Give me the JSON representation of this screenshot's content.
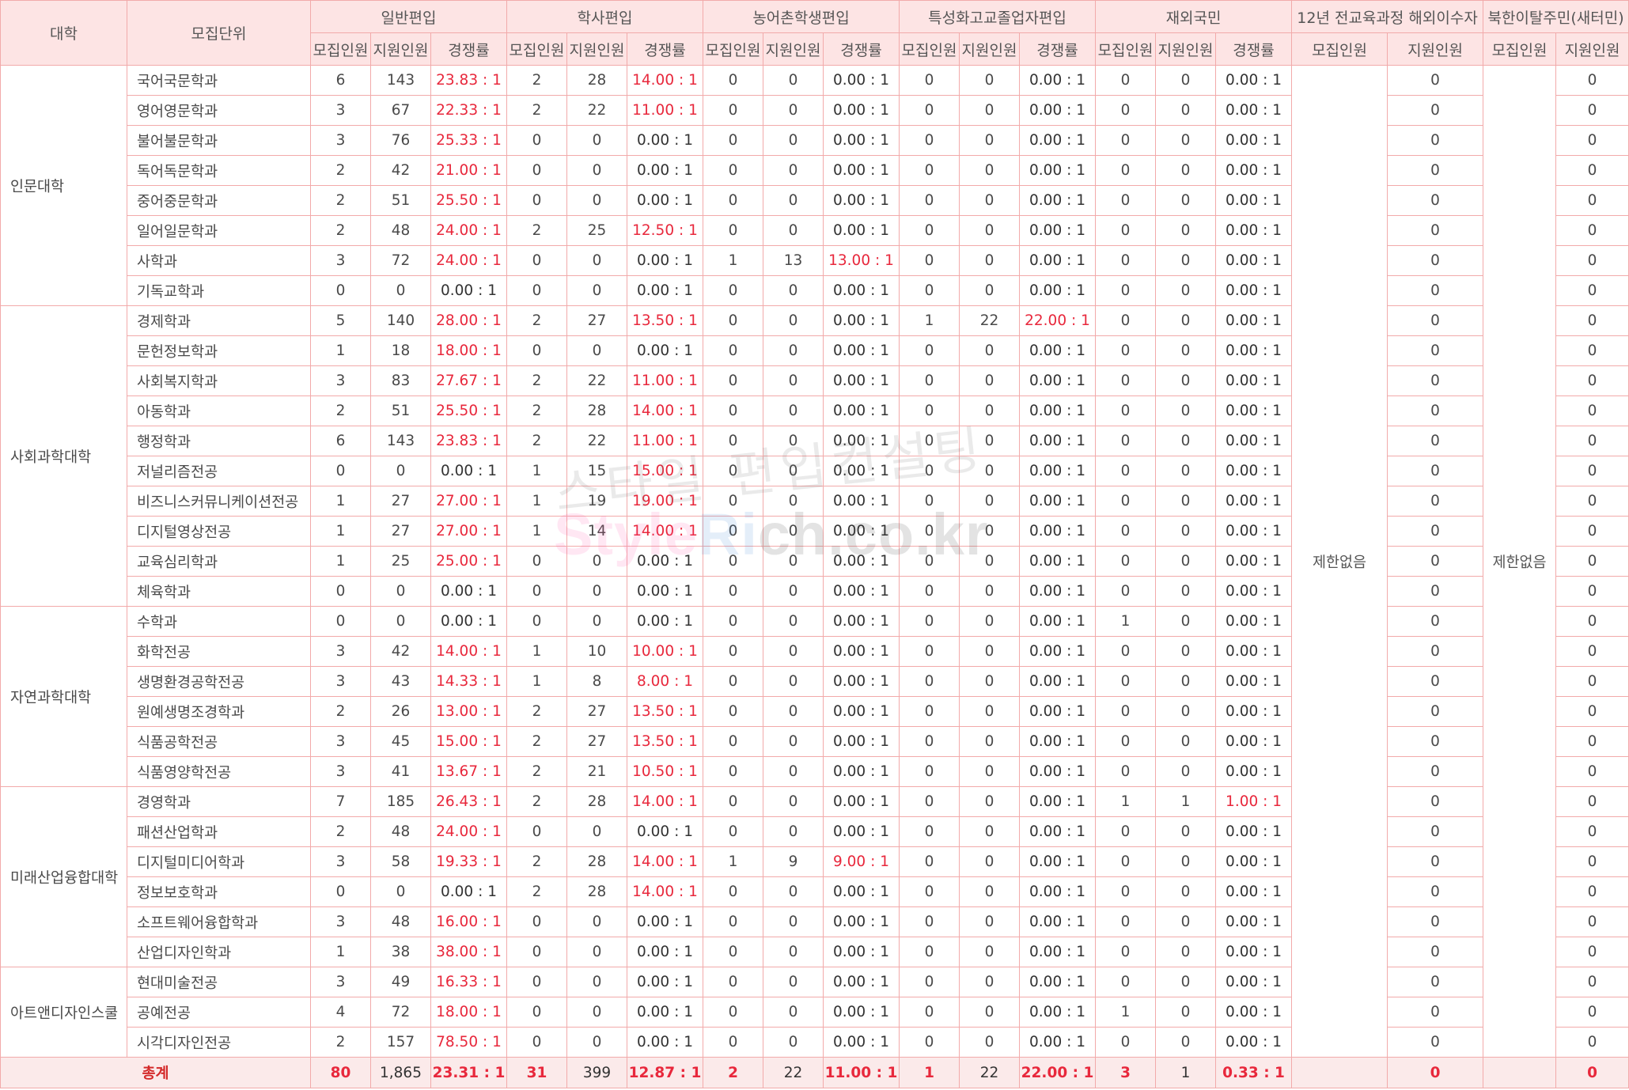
{
  "header": {
    "col_college": "대학",
    "col_unit": "모집단위",
    "groups": [
      "일반편입",
      "학사편입",
      "농어촌학생편입",
      "특성화고교졸업자편입",
      "재외국민",
      "12년 전교육과정 해외이수자",
      "북한이탈주민(새터민)"
    ],
    "sub": {
      "recruit": "모집인원",
      "apply": "지원인원",
      "rate": "경쟁률"
    }
  },
  "special_note": "제한없음",
  "colleges": [
    {
      "name": "인문대학",
      "rows": [
        {
          "unit": "국어국문학과",
          "v": [
            "6",
            "143",
            "23.83 : 1",
            "2",
            "28",
            "14.00 : 1",
            "0",
            "0",
            "0.00 : 1",
            "0",
            "0",
            "0.00 : 1",
            "0",
            "0",
            "0.00 : 1",
            "0",
            "0"
          ]
        },
        {
          "unit": "영어영문학과",
          "v": [
            "3",
            "67",
            "22.33 : 1",
            "2",
            "22",
            "11.00 : 1",
            "0",
            "0",
            "0.00 : 1",
            "0",
            "0",
            "0.00 : 1",
            "0",
            "0",
            "0.00 : 1",
            "0",
            "0"
          ]
        },
        {
          "unit": "불어불문학과",
          "v": [
            "3",
            "76",
            "25.33 : 1",
            "0",
            "0",
            "0.00 : 1",
            "0",
            "0",
            "0.00 : 1",
            "0",
            "0",
            "0.00 : 1",
            "0",
            "0",
            "0.00 : 1",
            "0",
            "0"
          ]
        },
        {
          "unit": "독어독문학과",
          "v": [
            "2",
            "42",
            "21.00 : 1",
            "0",
            "0",
            "0.00 : 1",
            "0",
            "0",
            "0.00 : 1",
            "0",
            "0",
            "0.00 : 1",
            "0",
            "0",
            "0.00 : 1",
            "0",
            "0"
          ]
        },
        {
          "unit": "중어중문학과",
          "v": [
            "2",
            "51",
            "25.50 : 1",
            "0",
            "0",
            "0.00 : 1",
            "0",
            "0",
            "0.00 : 1",
            "0",
            "0",
            "0.00 : 1",
            "0",
            "0",
            "0.00 : 1",
            "0",
            "0"
          ]
        },
        {
          "unit": "일어일문학과",
          "v": [
            "2",
            "48",
            "24.00 : 1",
            "2",
            "25",
            "12.50 : 1",
            "0",
            "0",
            "0.00 : 1",
            "0",
            "0",
            "0.00 : 1",
            "0",
            "0",
            "0.00 : 1",
            "0",
            "0"
          ]
        },
        {
          "unit": "사학과",
          "v": [
            "3",
            "72",
            "24.00 : 1",
            "0",
            "0",
            "0.00 : 1",
            "1",
            "13",
            "13.00 : 1",
            "0",
            "0",
            "0.00 : 1",
            "0",
            "0",
            "0.00 : 1",
            "0",
            "0"
          ]
        },
        {
          "unit": "기독교학과",
          "v": [
            "0",
            "0",
            "0.00 : 1",
            "0",
            "0",
            "0.00 : 1",
            "0",
            "0",
            "0.00 : 1",
            "0",
            "0",
            "0.00 : 1",
            "0",
            "0",
            "0.00 : 1",
            "0",
            "0"
          ]
        }
      ]
    },
    {
      "name": "사회과학대학",
      "rows": [
        {
          "unit": "경제학과",
          "v": [
            "5",
            "140",
            "28.00 : 1",
            "2",
            "27",
            "13.50 : 1",
            "0",
            "0",
            "0.00 : 1",
            "1",
            "22",
            "22.00 : 1",
            "0",
            "0",
            "0.00 : 1",
            "0",
            "0"
          ]
        },
        {
          "unit": "문헌정보학과",
          "v": [
            "1",
            "18",
            "18.00 : 1",
            "0",
            "0",
            "0.00 : 1",
            "0",
            "0",
            "0.00 : 1",
            "0",
            "0",
            "0.00 : 1",
            "0",
            "0",
            "0.00 : 1",
            "0",
            "0"
          ]
        },
        {
          "unit": "사회복지학과",
          "v": [
            "3",
            "83",
            "27.67 : 1",
            "2",
            "22",
            "11.00 : 1",
            "0",
            "0",
            "0.00 : 1",
            "0",
            "0",
            "0.00 : 1",
            "0",
            "0",
            "0.00 : 1",
            "0",
            "0"
          ]
        },
        {
          "unit": "아동학과",
          "v": [
            "2",
            "51",
            "25.50 : 1",
            "2",
            "28",
            "14.00 : 1",
            "0",
            "0",
            "0.00 : 1",
            "0",
            "0",
            "0.00 : 1",
            "0",
            "0",
            "0.00 : 1",
            "0",
            "0"
          ]
        },
        {
          "unit": "행정학과",
          "v": [
            "6",
            "143",
            "23.83 : 1",
            "2",
            "22",
            "11.00 : 1",
            "0",
            "0",
            "0.00 : 1",
            "0",
            "0",
            "0.00 : 1",
            "0",
            "0",
            "0.00 : 1",
            "0",
            "0"
          ]
        },
        {
          "unit": "저널리즘전공",
          "v": [
            "0",
            "0",
            "0.00 : 1",
            "1",
            "15",
            "15.00 : 1",
            "0",
            "0",
            "0.00 : 1",
            "0",
            "0",
            "0.00 : 1",
            "0",
            "0",
            "0.00 : 1",
            "0",
            "0"
          ]
        },
        {
          "unit": "비즈니스커뮤니케이션전공",
          "v": [
            "1",
            "27",
            "27.00 : 1",
            "1",
            "19",
            "19.00 : 1",
            "0",
            "0",
            "0.00 : 1",
            "0",
            "0",
            "0.00 : 1",
            "0",
            "0",
            "0.00 : 1",
            "0",
            "0"
          ]
        },
        {
          "unit": "디지털영상전공",
          "v": [
            "1",
            "27",
            "27.00 : 1",
            "1",
            "14",
            "14.00 : 1",
            "0",
            "0",
            "0.00 : 1",
            "0",
            "0",
            "0.00 : 1",
            "0",
            "0",
            "0.00 : 1",
            "0",
            "0"
          ]
        },
        {
          "unit": "교육심리학과",
          "v": [
            "1",
            "25",
            "25.00 : 1",
            "0",
            "0",
            "0.00 : 1",
            "0",
            "0",
            "0.00 : 1",
            "0",
            "0",
            "0.00 : 1",
            "0",
            "0",
            "0.00 : 1",
            "0",
            "0"
          ]
        },
        {
          "unit": "체육학과",
          "v": [
            "0",
            "0",
            "0.00 : 1",
            "0",
            "0",
            "0.00 : 1",
            "0",
            "0",
            "0.00 : 1",
            "0",
            "0",
            "0.00 : 1",
            "0",
            "0",
            "0.00 : 1",
            "0",
            "0"
          ]
        }
      ]
    },
    {
      "name": "자연과학대학",
      "rows": [
        {
          "unit": "수학과",
          "v": [
            "0",
            "0",
            "0.00 : 1",
            "0",
            "0",
            "0.00 : 1",
            "0",
            "0",
            "0.00 : 1",
            "0",
            "0",
            "0.00 : 1",
            "1",
            "0",
            "0.00 : 1",
            "0",
            "0"
          ]
        },
        {
          "unit": "화학전공",
          "v": [
            "3",
            "42",
            "14.00 : 1",
            "1",
            "10",
            "10.00 : 1",
            "0",
            "0",
            "0.00 : 1",
            "0",
            "0",
            "0.00 : 1",
            "0",
            "0",
            "0.00 : 1",
            "0",
            "0"
          ]
        },
        {
          "unit": "생명환경공학전공",
          "v": [
            "3",
            "43",
            "14.33 : 1",
            "1",
            "8",
            "8.00 : 1",
            "0",
            "0",
            "0.00 : 1",
            "0",
            "0",
            "0.00 : 1",
            "0",
            "0",
            "0.00 : 1",
            "0",
            "0"
          ]
        },
        {
          "unit": "원예생명조경학과",
          "v": [
            "2",
            "26",
            "13.00 : 1",
            "2",
            "27",
            "13.50 : 1",
            "0",
            "0",
            "0.00 : 1",
            "0",
            "0",
            "0.00 : 1",
            "0",
            "0",
            "0.00 : 1",
            "0",
            "0"
          ]
        },
        {
          "unit": "식품공학전공",
          "v": [
            "3",
            "45",
            "15.00 : 1",
            "2",
            "27",
            "13.50 : 1",
            "0",
            "0",
            "0.00 : 1",
            "0",
            "0",
            "0.00 : 1",
            "0",
            "0",
            "0.00 : 1",
            "0",
            "0"
          ]
        },
        {
          "unit": "식품영양학전공",
          "v": [
            "3",
            "41",
            "13.67 : 1",
            "2",
            "21",
            "10.50 : 1",
            "0",
            "0",
            "0.00 : 1",
            "0",
            "0",
            "0.00 : 1",
            "0",
            "0",
            "0.00 : 1",
            "0",
            "0"
          ]
        }
      ]
    },
    {
      "name": "미래산업융합대학",
      "rows": [
        {
          "unit": "경영학과",
          "v": [
            "7",
            "185",
            "26.43 : 1",
            "2",
            "28",
            "14.00 : 1",
            "0",
            "0",
            "0.00 : 1",
            "0",
            "0",
            "0.00 : 1",
            "1",
            "1",
            "1.00 : 1",
            "0",
            "0"
          ]
        },
        {
          "unit": "패션산업학과",
          "v": [
            "2",
            "48",
            "24.00 : 1",
            "0",
            "0",
            "0.00 : 1",
            "0",
            "0",
            "0.00 : 1",
            "0",
            "0",
            "0.00 : 1",
            "0",
            "0",
            "0.00 : 1",
            "0",
            "0"
          ]
        },
        {
          "unit": "디지털미디어학과",
          "v": [
            "3",
            "58",
            "19.33 : 1",
            "2",
            "28",
            "14.00 : 1",
            "1",
            "9",
            "9.00 : 1",
            "0",
            "0",
            "0.00 : 1",
            "0",
            "0",
            "0.00 : 1",
            "0",
            "0"
          ]
        },
        {
          "unit": "정보보호학과",
          "v": [
            "0",
            "0",
            "0.00 : 1",
            "2",
            "28",
            "14.00 : 1",
            "0",
            "0",
            "0.00 : 1",
            "0",
            "0",
            "0.00 : 1",
            "0",
            "0",
            "0.00 : 1",
            "0",
            "0"
          ]
        },
        {
          "unit": "소프트웨어융합학과",
          "v": [
            "3",
            "48",
            "16.00 : 1",
            "0",
            "0",
            "0.00 : 1",
            "0",
            "0",
            "0.00 : 1",
            "0",
            "0",
            "0.00 : 1",
            "0",
            "0",
            "0.00 : 1",
            "0",
            "0"
          ]
        },
        {
          "unit": "산업디자인학과",
          "v": [
            "1",
            "38",
            "38.00 : 1",
            "0",
            "0",
            "0.00 : 1",
            "0",
            "0",
            "0.00 : 1",
            "0",
            "0",
            "0.00 : 1",
            "0",
            "0",
            "0.00 : 1",
            "0",
            "0"
          ]
        }
      ]
    },
    {
      "name": "아트앤디자인스쿨",
      "rows": [
        {
          "unit": "현대미술전공",
          "v": [
            "3",
            "49",
            "16.33 : 1",
            "0",
            "0",
            "0.00 : 1",
            "0",
            "0",
            "0.00 : 1",
            "0",
            "0",
            "0.00 : 1",
            "0",
            "0",
            "0.00 : 1",
            "0",
            "0"
          ]
        },
        {
          "unit": "공예전공",
          "v": [
            "4",
            "72",
            "18.00 : 1",
            "0",
            "0",
            "0.00 : 1",
            "0",
            "0",
            "0.00 : 1",
            "0",
            "0",
            "0.00 : 1",
            "1",
            "0",
            "0.00 : 1",
            "0",
            "0"
          ]
        },
        {
          "unit": "시각디자인전공",
          "v": [
            "2",
            "157",
            "78.50 : 1",
            "0",
            "0",
            "0.00 : 1",
            "0",
            "0",
            "0.00 : 1",
            "0",
            "0",
            "0.00 : 1",
            "0",
            "0",
            "0.00 : 1",
            "0",
            "0"
          ]
        }
      ]
    }
  ],
  "total": {
    "label": "총계",
    "v": [
      "80",
      "1,865",
      "23.31 : 1",
      "31",
      "399",
      "12.87 : 1",
      "2",
      "22",
      "11.00 : 1",
      "1",
      "22",
      "22.00 : 1",
      "3",
      "1",
      "0.33 : 1",
      "0",
      "0"
    ]
  },
  "watermark": {
    "line1": "스타일 편입컨설팅",
    "line2_a": "Style",
    "line2_b": "Ri",
    "line2_c": "ch.co.kr"
  }
}
